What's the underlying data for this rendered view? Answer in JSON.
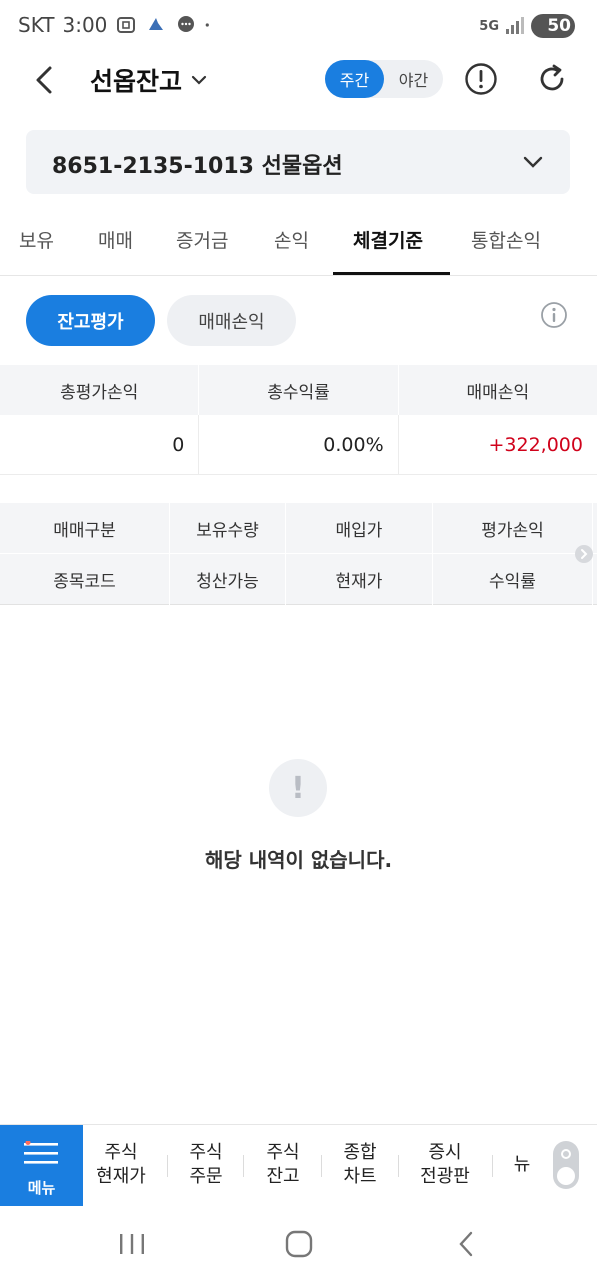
{
  "status_bar": {
    "carrier": "SKT",
    "time": "3:00",
    "network": "5G",
    "battery": "50",
    "icons": [
      "screenshot-icon",
      "app-notification-icon",
      "message-icon",
      "dot-icon",
      "signal-icon"
    ]
  },
  "header": {
    "title": "선옵잔고",
    "segment": {
      "options": [
        "주간",
        "야간"
      ],
      "selected": "주간"
    },
    "icons": [
      "back-arrow-icon",
      "chevron-down-icon",
      "alert-icon",
      "refresh-icon"
    ]
  },
  "account": {
    "label": "8651-2135-1013 선물옵션"
  },
  "tabs": {
    "items": [
      "보유",
      "매매",
      "증거금",
      "손익",
      "체결기준",
      "통합손익"
    ],
    "active": "체결기준"
  },
  "sub_buttons": {
    "items": [
      "잔고평가",
      "매매손익"
    ],
    "active": "잔고평가"
  },
  "summary": {
    "headers": [
      "총평가손익",
      "총수익률",
      "매매손익"
    ],
    "values": [
      "0",
      "0.00%",
      "+322,000"
    ],
    "colors": {
      "positive": "#d0021b"
    }
  },
  "detail_header": {
    "row1": [
      "매매구분",
      "보유수량",
      "매입가",
      "평가손익"
    ],
    "row2": [
      "종목코드",
      "청산가능",
      "현재가",
      "수익률"
    ]
  },
  "empty_state": {
    "icon": "!",
    "message": "해당 내역이 없습니다."
  },
  "quick_menu": {
    "menu_label": "메뉴",
    "items": [
      {
        "line1": "주식",
        "line2": "현재가"
      },
      {
        "line1": "주식",
        "line2": "주문"
      },
      {
        "line1": "주식",
        "line2": "잔고"
      },
      {
        "line1": "종합",
        "line2": "차트"
      },
      {
        "line1": "증시",
        "line2": "전광판"
      },
      {
        "line1": "뉴",
        "line2": ""
      }
    ]
  },
  "theme": {
    "accent": "#1a7ee0",
    "background_gray": "#f4f5f7"
  }
}
